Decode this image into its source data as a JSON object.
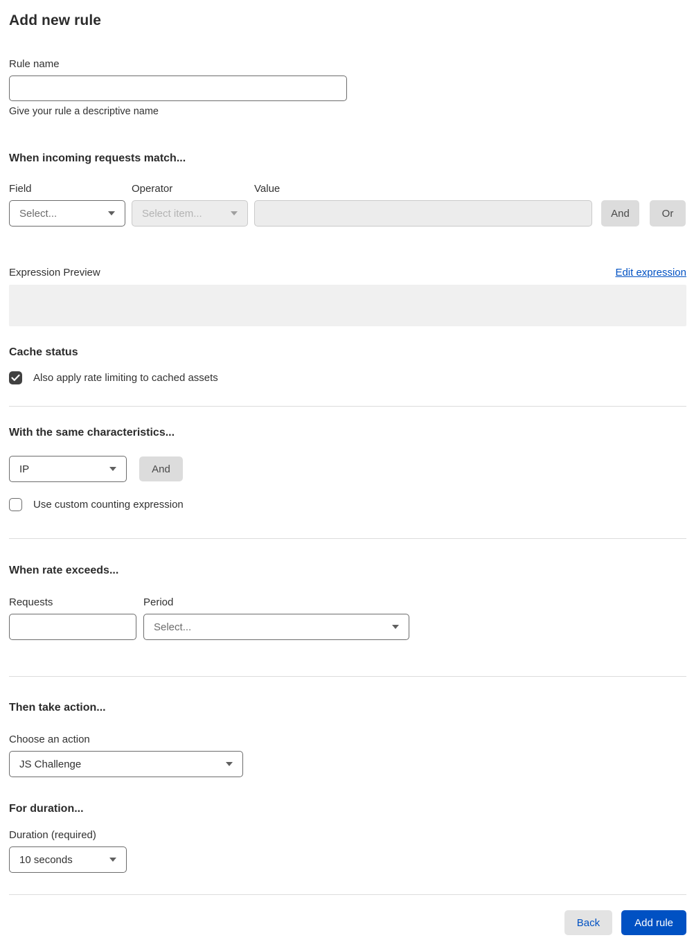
{
  "page": {
    "title": "Add new rule"
  },
  "colors": {
    "accent_blue": "#0051c3",
    "checkbox_checked": "#414141",
    "disabled_bg": "#ececec",
    "preview_bg": "#f0f0f0",
    "gray_button_bg": "#dcdcdc"
  },
  "rule_name": {
    "label": "Rule name",
    "value": "",
    "placeholder": "",
    "helper": "Give your rule a descriptive name"
  },
  "match": {
    "heading": "When incoming requests match...",
    "field": {
      "label": "Field",
      "value": "Select...",
      "is_placeholder": true
    },
    "operator": {
      "label": "Operator",
      "value": "Select item...",
      "disabled": true
    },
    "value": {
      "label": "Value",
      "value": "",
      "disabled": true
    },
    "and_label": "And",
    "or_label": "Or"
  },
  "expression": {
    "label": "Expression Preview",
    "edit_link": "Edit expression",
    "preview": ""
  },
  "cache": {
    "heading": "Cache status",
    "checkbox_label": "Also apply rate limiting to cached assets",
    "checked": true
  },
  "characteristics": {
    "heading": "With the same characteristics...",
    "select_value": "IP",
    "and_label": "And",
    "checkbox_label": "Use custom counting expression",
    "checked": false
  },
  "rate": {
    "heading": "When rate exceeds...",
    "requests": {
      "label": "Requests",
      "value": ""
    },
    "period": {
      "label": "Period",
      "value": "Select...",
      "is_placeholder": true
    }
  },
  "action": {
    "heading": "Then take action...",
    "label": "Choose an action",
    "value": "JS Challenge"
  },
  "duration": {
    "heading": "For duration...",
    "label": "Duration (required)",
    "value": "10 seconds"
  },
  "footer": {
    "back_label": "Back",
    "submit_label": "Add rule"
  }
}
